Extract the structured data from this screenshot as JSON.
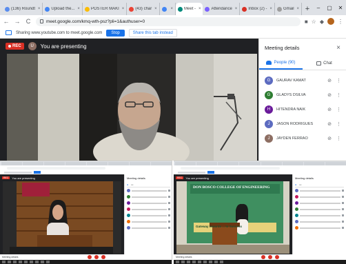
{
  "browser": {
    "tabs": [
      {
        "label": "(136) Roundt",
        "favicon_color": "#5a8dee"
      },
      {
        "label": "Upload the...",
        "favicon_color": "#4285f4"
      },
      {
        "label": "POSTER MAKI",
        "favicon_color": "#fbbc04"
      },
      {
        "label": "(43) char",
        "favicon_color": "#ea4335"
      },
      {
        "label": "",
        "favicon_color": "#4285f4"
      },
      {
        "label": "Meet - ",
        "favicon_color": "#00897b",
        "active": true
      },
      {
        "label": "Attendance",
        "favicon_color": "#7b61ff"
      },
      {
        "label": "Inbox (2) - ",
        "favicon_color": "#d93025"
      },
      {
        "label": "Gmail",
        "favicon_color": "#9e9e9e"
      }
    ],
    "new_tab_label": "+",
    "window_controls": [
      "–",
      "▢",
      "✕"
    ],
    "url": "meet.google.com/kmq-wth-psz?pli=1&authuser=0",
    "nav": {
      "back": "←",
      "forward": "→",
      "reload": "C"
    }
  },
  "share_bar": {
    "message": "Sharing www.youtube.com to meet.google.com",
    "stop_label": "Stop",
    "switch_label": "Share this tab instead"
  },
  "meet": {
    "rec_label": "REC",
    "presenter_initial": "U",
    "presenting_text": "You are presenting"
  },
  "panel": {
    "title": "Meeting details",
    "close": "×",
    "tab_people": "People (90)",
    "tab_chat": "Chat",
    "participants": [
      {
        "name": "GAURAV KAMAT",
        "initial": "G",
        "color": "#5c6bc0"
      },
      {
        "name": "GLADYS DSILVA",
        "initial": "G",
        "color": "#2e7d32"
      },
      {
        "name": "HITENDRA NAIK",
        "initial": "H",
        "color": "#6a1b9a"
      },
      {
        "name": "JASON RODRIGUES",
        "initial": "J",
        "color": "#5c6bc0"
      },
      {
        "name": "JAYDEN FERRAO",
        "initial": "J",
        "color": "#8d6e63"
      }
    ]
  },
  "bottom_left": {
    "presenting_text": "You are presenting",
    "rec_label": "REC",
    "panel_title": "Meeting details",
    "bar_label": "Meeting details"
  },
  "bottom_right": {
    "presenting_text": "You are presenting",
    "rec_label": "REC",
    "panel_title": "Meeting details",
    "bar_label": "Meeting details",
    "banner_text": "DON BOSCO COLLEGE OF ENGINEERING",
    "subtext": "Gateway towards ... to Success"
  }
}
